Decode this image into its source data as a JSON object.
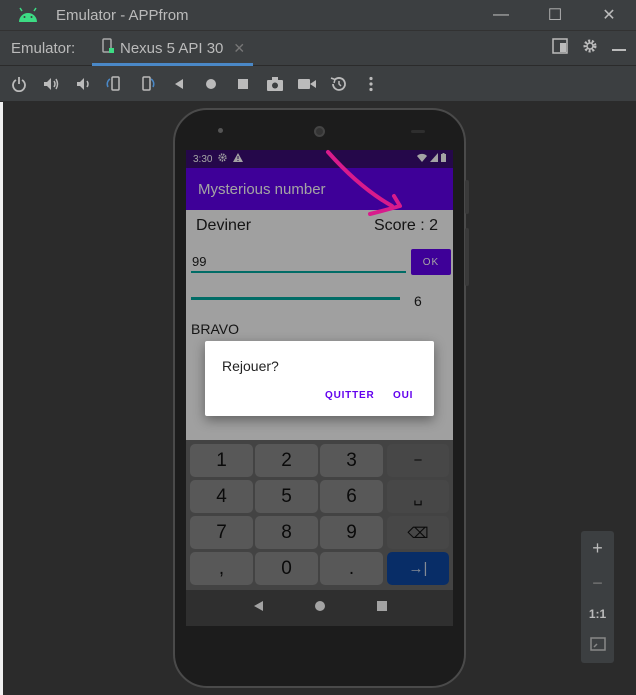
{
  "window": {
    "title": "Emulator - APPfrom",
    "minimize_glyph": "—",
    "maximize_glyph": "☐",
    "close_glyph": "✕"
  },
  "tabbar": {
    "label": "Emulator:",
    "tab_title": "Nexus 5 API 30",
    "tab_close": "✕"
  },
  "toolbar": {
    "icons": [
      "power-icon",
      "volume-up-icon",
      "volume-down-icon",
      "rotate-left-icon",
      "rotate-right-icon",
      "back-icon",
      "home-icon",
      "overview-icon",
      "camera-icon",
      "video-icon",
      "snapshot-icon",
      "more-icon"
    ]
  },
  "statusbar": {
    "time": "3:30"
  },
  "app": {
    "title": "Mysterious number",
    "deviner_label": "Deviner",
    "score_label": "Score : 2",
    "input_value": "99",
    "ok_label": "OK",
    "slider_value": "6",
    "result_text": "BRAVO"
  },
  "dialog": {
    "message": "Rejouer?",
    "quit_label": "QUITTER",
    "yes_label": "OUI"
  },
  "keyboard": {
    "keys": [
      "1",
      "2",
      "3",
      "−",
      "4",
      "5",
      "6",
      "␣",
      "7",
      "8",
      "9",
      "⌫",
      ",",
      "0",
      ".",
      "→|"
    ]
  },
  "zoom_panel": {
    "zoom_in": "+",
    "zoom_out": "−",
    "one_to_one": "1:1"
  },
  "colors": {
    "accent": "#6200ee",
    "status_bar": "#3a0e74",
    "teal": "#03a9a0",
    "annotation": "#d81b8c",
    "ide_bg": "#3c3f41"
  }
}
